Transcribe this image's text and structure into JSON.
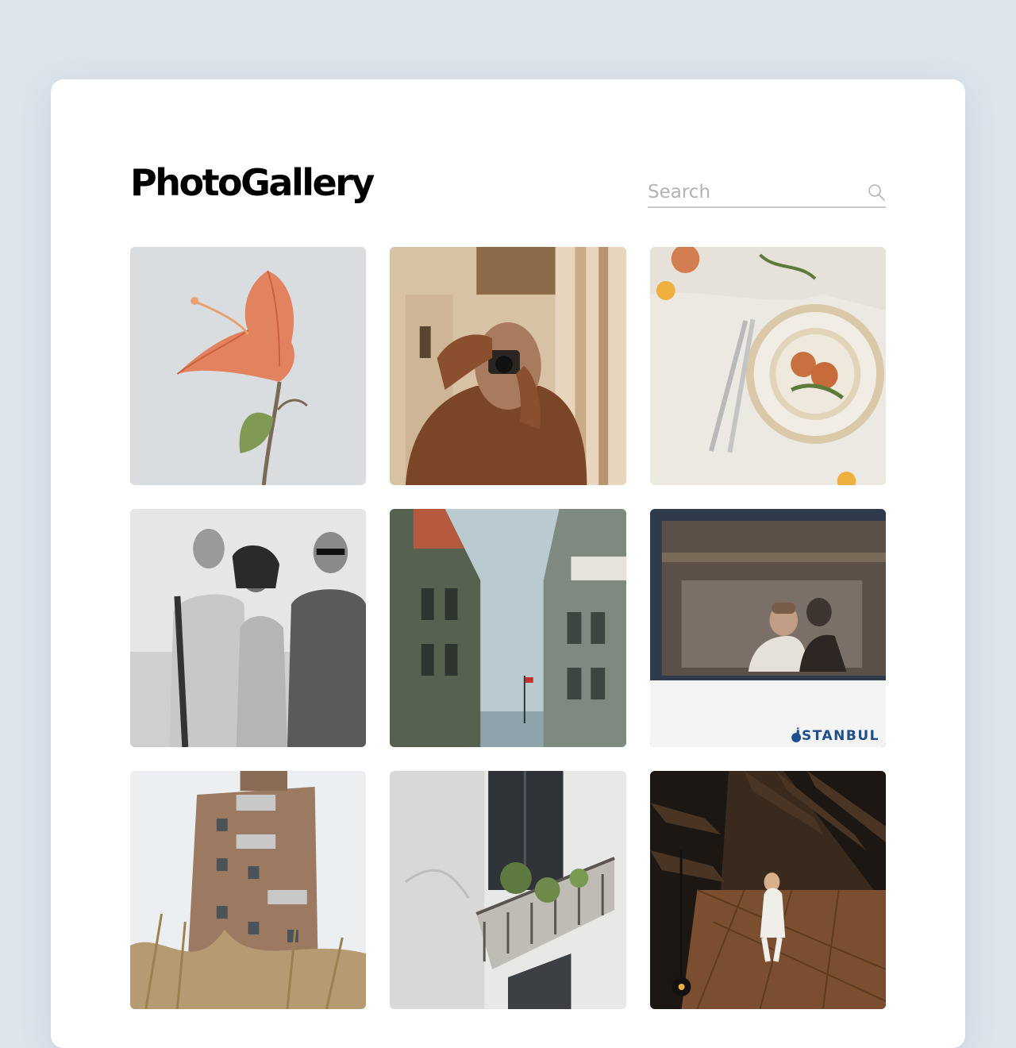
{
  "header": {
    "title": "PhotoGallery"
  },
  "search": {
    "placeholder": "Search",
    "value": "",
    "icon": "search-icon"
  },
  "photos": [
    {
      "subject": "flower"
    },
    {
      "subject": "photographer"
    },
    {
      "subject": "table-setting"
    },
    {
      "subject": "friends"
    },
    {
      "subject": "street"
    },
    {
      "subject": "tram-window",
      "sign_text": "İSTANBUL"
    },
    {
      "subject": "building"
    },
    {
      "subject": "balcony"
    },
    {
      "subject": "church-aisle"
    }
  ]
}
